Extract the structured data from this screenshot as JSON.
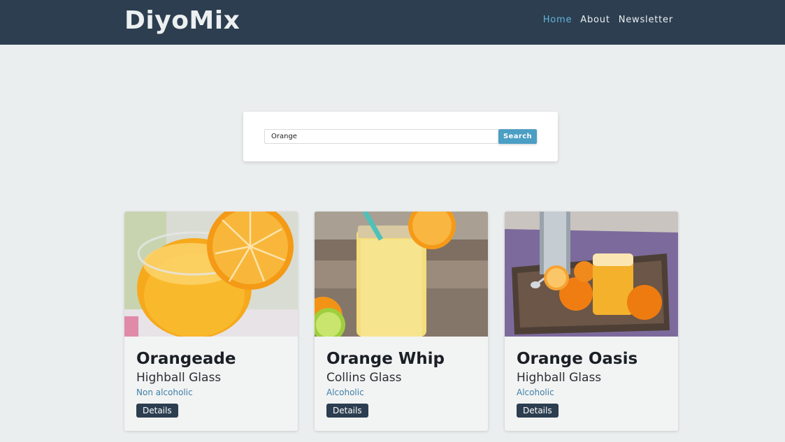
{
  "nav": {
    "brand": "DiyoMix",
    "links": [
      "Home",
      "About",
      "Newsletter"
    ],
    "active": "Home"
  },
  "search": {
    "value": "Orange",
    "button_label": "Search"
  },
  "drinks": [
    {
      "name": "Orangeade",
      "glass": "Highball Glass",
      "type": "Non alcoholic",
      "button_label": "Details"
    },
    {
      "name": "Orange Whip",
      "glass": "Collins Glass",
      "type": "Alcoholic",
      "button_label": "Details"
    },
    {
      "name": "Orange Oasis",
      "glass": "Highball Glass",
      "type": "Alcoholic",
      "button_label": "Details"
    }
  ],
  "colors": {
    "navbar": "#2c3e50",
    "accent": "#4b9ec4",
    "active_link": "#62b5da",
    "page_bg": "#ebeeef"
  }
}
